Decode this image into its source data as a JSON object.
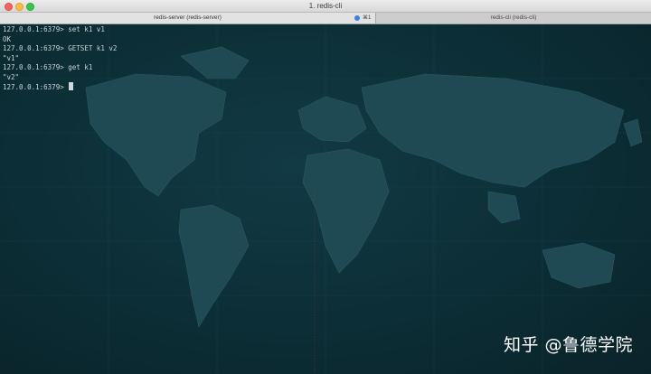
{
  "window": {
    "title": "1. redis-cli"
  },
  "tabs": [
    {
      "label": "redis-server (redis-server)",
      "shortcut": "⌘1"
    },
    {
      "label": "redis-cli (redis-cli)"
    }
  ],
  "terminal": {
    "lines": [
      "127.0.0.1:6379> set k1 v1",
      "OK",
      "127.0.0.1:6379> GETSET k1 v2",
      "\"v1\"",
      "127.0.0.1:6379> get k1",
      "\"v2\""
    ],
    "prompt": "127.0.0.1:6379> "
  },
  "watermark": "知乎 @鲁德学院",
  "colors": {
    "terminal_bg": "#0b2a32",
    "terminal_text": "#c9d6d8",
    "active_tab_indicator": "#3b82e8"
  }
}
